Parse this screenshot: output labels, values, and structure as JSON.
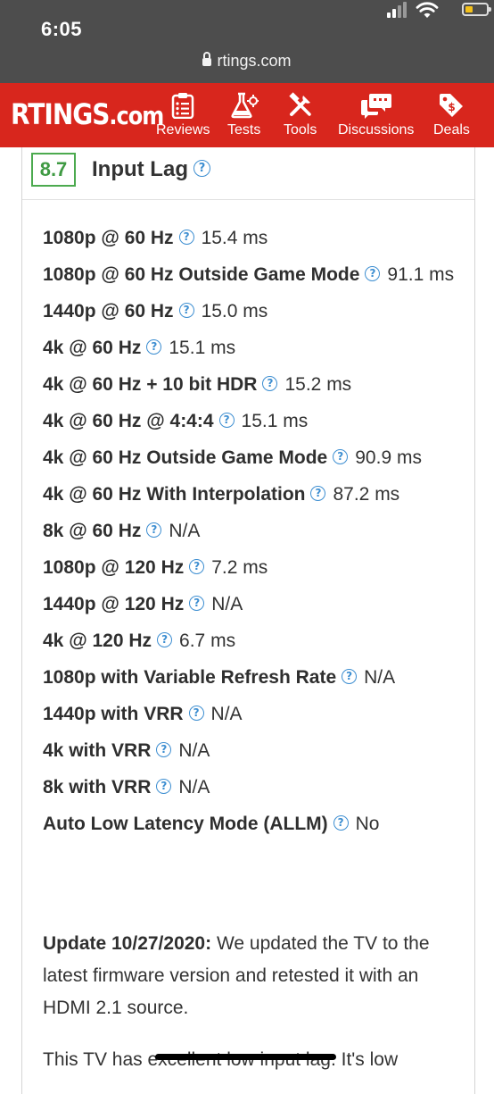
{
  "status_bar": {
    "time": "6:05"
  },
  "browser": {
    "url": "rtings.com"
  },
  "nav": {
    "logo_main": "RTINGS",
    "logo_suffix": ".com",
    "items": [
      {
        "label": "Reviews",
        "icon": "clipboard-icon"
      },
      {
        "label": "Tests",
        "icon": "flask-icon"
      },
      {
        "label": "Tools",
        "icon": "tools-icon"
      },
      {
        "label": "Discussions",
        "icon": "chat-icon"
      },
      {
        "label": "Deals",
        "icon": "tag-icon"
      }
    ]
  },
  "section": {
    "score": "8.7",
    "title": "Input Lag",
    "help_glyph": "?"
  },
  "rows": [
    {
      "label": "1080p @ 60 Hz",
      "value": "15.4 ms"
    },
    {
      "label": "1080p @ 60 Hz Outside Game Mode",
      "value": "91.1 ms"
    },
    {
      "label": "1440p @ 60 Hz",
      "value": "15.0 ms"
    },
    {
      "label": "4k @ 60 Hz",
      "value": "15.1 ms"
    },
    {
      "label": "4k @ 60 Hz + 10 bit HDR",
      "value": "15.2 ms"
    },
    {
      "label": "4k @ 60 Hz @ 4:4:4",
      "value": "15.1 ms"
    },
    {
      "label": "4k @ 60 Hz Outside Game Mode",
      "value": "90.9 ms"
    },
    {
      "label": "4k @ 60 Hz With Interpolation",
      "value": "87.2 ms"
    },
    {
      "label": "8k @ 60 Hz",
      "value": "N/A"
    },
    {
      "label": "1080p @ 120 Hz",
      "value": "7.2 ms"
    },
    {
      "label": "1440p @ 120 Hz",
      "value": "N/A"
    },
    {
      "label": "4k @ 120 Hz",
      "value": "6.7 ms"
    },
    {
      "label": "1080p with Variable Refresh Rate",
      "value": "N/A"
    },
    {
      "label": "1440p with VRR",
      "value": "N/A"
    },
    {
      "label": "4k with VRR",
      "value": "N/A"
    },
    {
      "label": "8k with VRR",
      "value": "N/A"
    },
    {
      "label": "Auto Low Latency Mode (ALLM)",
      "value": "No"
    }
  ],
  "update": {
    "heading": "Update 10/27/2020:",
    "text": "We updated the TV to the latest firmware version and retested it with an HDMI 2.1 source."
  },
  "paragraph": "This TV has excellent low input lag. It's low",
  "colors": {
    "nav_red": "#d8261d",
    "score_green": "#4caa4f",
    "help_blue": "#3d8ed1",
    "status_bar_gray": "#4d4d4d"
  }
}
